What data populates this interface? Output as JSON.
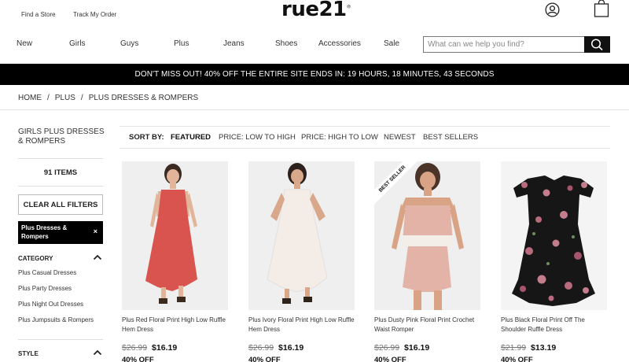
{
  "header": {
    "find_store": "Find a Store",
    "track_order": "Track My Order",
    "logo": "rue21",
    "logo_mark": "®"
  },
  "icons": {
    "account": "account-icon",
    "bag": "shopping-bag-icon",
    "search": "search-icon",
    "chevron": "chevron-up-icon",
    "close": "close-icon"
  },
  "nav": {
    "items": [
      "New",
      "Girls",
      "Guys",
      "Plus",
      "Jeans",
      "Shoes",
      "Accessories",
      "Sale"
    ]
  },
  "search": {
    "placeholder": "What can we help you find?",
    "value": ""
  },
  "promo": {
    "text": "DON'T MISS OUT! 40% OFF THE ENTIRE SITE ENDS IN: 19 HOURS, 18 MINUTES, 43 SECONDS"
  },
  "breadcrumb": {
    "items": [
      "HOME",
      "PLUS",
      "PLUS DRESSES & ROMPERS"
    ],
    "separator": "/"
  },
  "sidebar": {
    "title": "GIRLS PLUS DRESSES & ROMPERS",
    "items_count": "91 ITEMS",
    "clear_filters": "CLEAR ALL FILTERS",
    "active_filter": "Plus Dresses & Rompers",
    "active_filter_remove": "×",
    "category": {
      "heading": "CATEGORY",
      "links": [
        "Plus Casual Dresses",
        "Plus Party Dresses",
        "Plus Night Out Dresses",
        "Plus Jumpsuits & Rompers"
      ]
    },
    "style": {
      "heading": "STYLE"
    }
  },
  "sort": {
    "label": "SORT BY:",
    "options": [
      "FEATURED",
      "PRICE: LOW TO HIGH",
      "PRICE: HIGH TO LOW",
      "NEWEST",
      "BEST SELLERS"
    ],
    "selected": "FEATURED"
  },
  "products": [
    {
      "name": "Plus Red Floral Print High Low Ruffle Hem Dress",
      "original_price": "$26.99",
      "sale_price": "$16.19",
      "discount": "40% OFF",
      "dress_color": "#d9534f"
    },
    {
      "name": "Plus Ivory Floral Print High Low Ruffle Hem Dress",
      "original_price": "$26.99",
      "sale_price": "$16.19",
      "discount": "40% OFF",
      "dress_color": "#f4ece6"
    },
    {
      "name": "Plus Dusty Pink Floral Print Crochet Waist Romper",
      "original_price": "$26.99",
      "sale_price": "$16.19",
      "discount": "40% OFF",
      "badge": "BEST SELLER",
      "dress_color": "#e3b3a8"
    },
    {
      "name": "Plus Black Floral Print Off The Shoulder Ruffle Dress",
      "original_price": "$21.99",
      "sale_price": "$13.19",
      "discount": "40% OFF",
      "dress_color": "#161616"
    }
  ]
}
